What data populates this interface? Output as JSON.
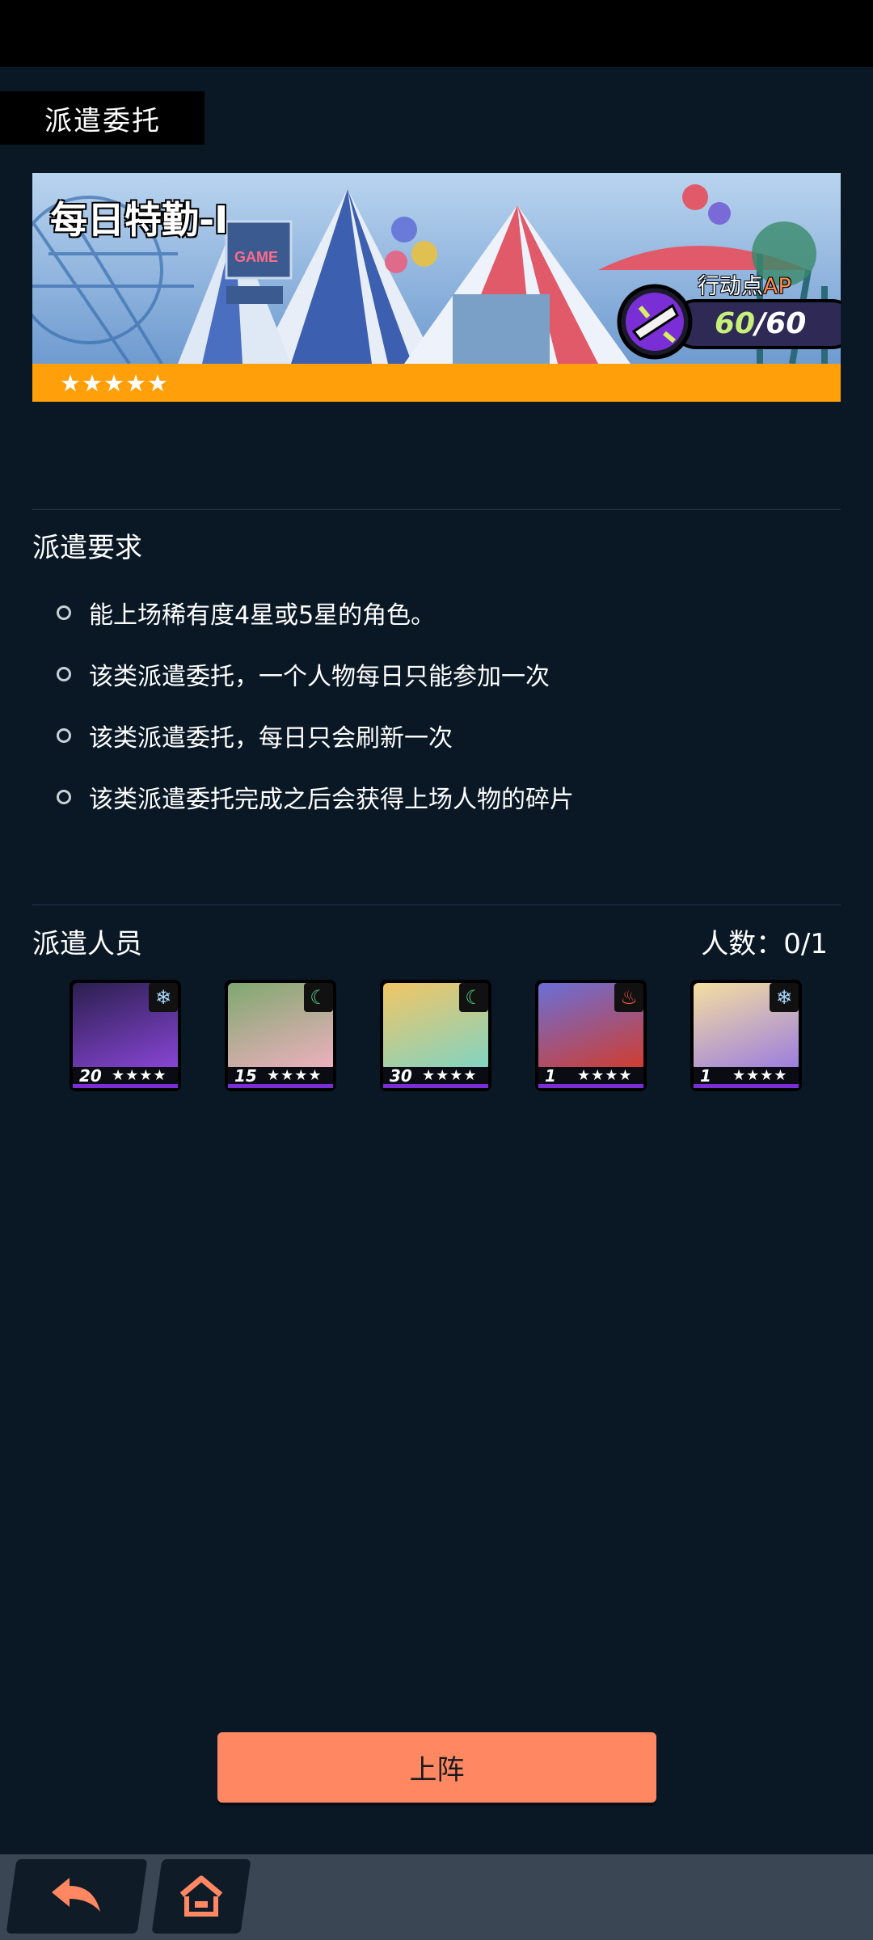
{
  "header": {
    "title": "派遣委托"
  },
  "banner": {
    "name": "每日特勤-Ⅰ",
    "stars": "★★★★★",
    "ap_label_prefix": "行动点",
    "ap_label_suffix": "AP",
    "ap_current": "60",
    "ap_max": "/60"
  },
  "requirements": {
    "title": "派遣要求",
    "items": [
      "能上场稀有度4星或5星的角色。",
      "该类派遣委托，一个人物每日只能参加一次",
      "该类派遣委托，每日只会刷新一次",
      "该类派遣委托完成之后会获得上场人物的碎片"
    ]
  },
  "personnel": {
    "title": "派遣人员",
    "count_label": "人数：",
    "count_value": "0/1",
    "characters": [
      {
        "level": "20",
        "stars": "★★★★",
        "element_icon": "snowflake-icon",
        "element_glyph": "❄",
        "element_color": "#a9d8ff",
        "portrait_top": "#2a1f4e",
        "portrait_bottom": "#8a46d8"
      },
      {
        "level": "15",
        "stars": "★★★★",
        "element_icon": "wind-icon",
        "element_glyph": "☾",
        "element_color": "#4fd08c",
        "portrait_top": "#7fa86f",
        "portrait_bottom": "#f0b0c0"
      },
      {
        "level": "30",
        "stars": "★★★★",
        "element_icon": "wind-icon",
        "element_glyph": "☾",
        "element_color": "#4fd08c",
        "portrait_top": "#f2c565",
        "portrait_bottom": "#7fd4c4"
      },
      {
        "level": "1",
        "stars": "★★★★",
        "element_icon": "fire-icon",
        "element_glyph": "♨",
        "element_color": "#ff5a4a",
        "portrait_top": "#6a6fd8",
        "portrait_bottom": "#d23c2c"
      },
      {
        "level": "1",
        "stars": "★★★★",
        "element_icon": "snowflake-icon",
        "element_glyph": "❄",
        "element_color": "#a9d8ff",
        "portrait_top": "#f4dfa0",
        "portrait_bottom": "#9a7be0"
      }
    ]
  },
  "actions": {
    "deploy_label": "上阵"
  },
  "nav": {
    "back_icon": "back-arrow-icon",
    "home_icon": "home-icon"
  },
  "colors": {
    "accent": "#ff8863",
    "banner_strip": "#ff9f0a",
    "background": "#0a1826"
  }
}
